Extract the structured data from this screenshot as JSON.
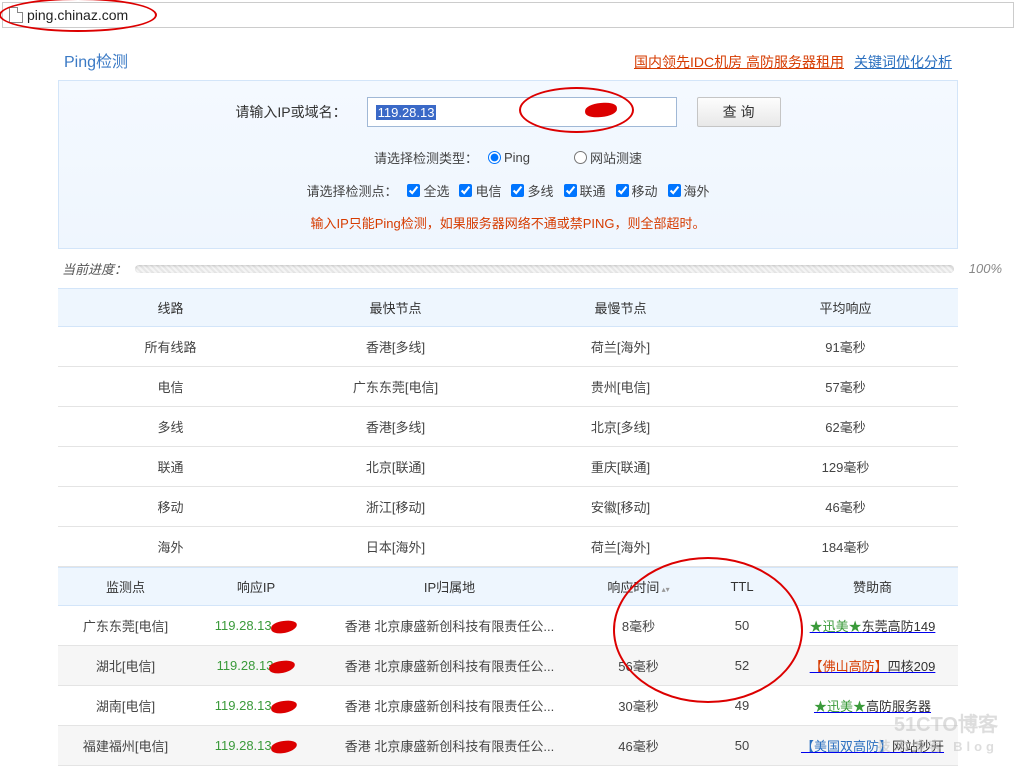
{
  "url": "ping.chinaz.com",
  "nav": {
    "title": "Ping检测",
    "ad1": "国内领先IDC机房 高防服务器租用",
    "ad2": "关键词优化分析"
  },
  "query": {
    "label": "请输入IP或域名：",
    "value": "119.28.13",
    "button": "查 询"
  },
  "opts": {
    "typeLabel": "请选择检测类型：",
    "pingLabel": "Ping",
    "speedLabel": "网站测速",
    "nodeLabel": "请选择检测点：",
    "all": "全选",
    "ct": "电信",
    "dx": "多线",
    "cu": "联通",
    "cm": "移动",
    "ov": "海外"
  },
  "hint": "输入IP只能Ping检测，如果服务器网络不通或禁PING，则全部超时。",
  "progress": {
    "label": "当前进度：",
    "pct": "100%"
  },
  "summary": {
    "head": {
      "line": "线路",
      "fast": "最快节点",
      "slow": "最慢节点",
      "avg": "平均响应"
    },
    "rows": [
      {
        "line": "所有线路",
        "fast": "香港[多线]",
        "slow": "荷兰[海外]",
        "avg": "91毫秒"
      },
      {
        "line": "电信",
        "fast": "广东东莞[电信]",
        "slow": "贵州[电信]",
        "avg": "57毫秒"
      },
      {
        "line": "多线",
        "fast": "香港[多线]",
        "slow": "北京[多线]",
        "avg": "62毫秒"
      },
      {
        "line": "联通",
        "fast": "北京[联通]",
        "slow": "重庆[联通]",
        "avg": "129毫秒"
      },
      {
        "line": "移动",
        "fast": "浙江[移动]",
        "slow": "安徽[移动]",
        "avg": "46毫秒"
      },
      {
        "line": "海外",
        "fast": "日本[海外]",
        "slow": "荷兰[海外]",
        "avg": "184毫秒"
      }
    ]
  },
  "detail": {
    "head": {
      "node": "监测点",
      "ip": "响应IP",
      "loc": "IP归属地",
      "rt": "响应时间",
      "ttl": "TTL",
      "sponsor": "赞助商"
    },
    "rows": [
      {
        "node": "广东东莞[电信]",
        "ip": "119.28.13.",
        "loc": "香港 北京康盛新创科技有限责任公...",
        "rt": "8毫秒",
        "ttl": "50",
        "sp_pre": "★迅美★",
        "sp_suf": "东莞高防149",
        "cls": "green-sp"
      },
      {
        "node": "湖北[电信]",
        "ip": "119.28.13",
        "loc": "香港 北京康盛新创科技有限责任公...",
        "rt": "56毫秒",
        "ttl": "52",
        "sp_pre": "【佛山高防】",
        "sp_suf": "四核209",
        "cls": "red-sp"
      },
      {
        "node": "湖南[电信]",
        "ip": "119.28.13.",
        "loc": "香港 北京康盛新创科技有限责任公...",
        "rt": "30毫秒",
        "ttl": "49",
        "sp_pre": "★迅美★",
        "sp_suf": "高防服务器",
        "cls": "green-sp"
      },
      {
        "node": "福建福州[电信]",
        "ip": "119.28.13.",
        "loc": "香港 北京康盛新创科技有限责任公...",
        "rt": "46毫秒",
        "ttl": "50",
        "sp_pre": "【美国双高防】",
        "sp_suf": "网站秒开",
        "cls": "blue-sp"
      }
    ]
  },
  "watermark": {
    "l1": "51CTO博客",
    "l2": "技术博客 Blog"
  }
}
